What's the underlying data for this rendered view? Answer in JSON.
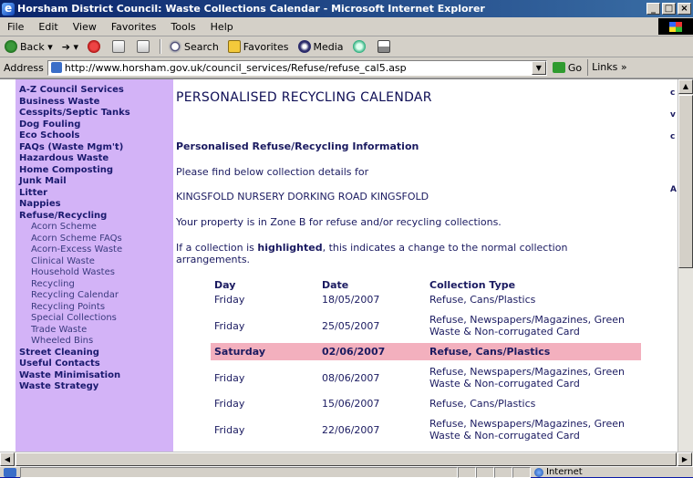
{
  "window": {
    "title": "Horsham District Council: Waste Collections Calendar - Microsoft Internet Explorer"
  },
  "menu": [
    {
      "label": "File"
    },
    {
      "label": "Edit"
    },
    {
      "label": "View"
    },
    {
      "label": "Favorites"
    },
    {
      "label": "Tools"
    },
    {
      "label": "Help"
    }
  ],
  "toolbar": {
    "back_label": "Back",
    "search_label": "Search",
    "favorites_label": "Favorites",
    "media_label": "Media"
  },
  "address": {
    "label": "Address",
    "url": "http://www.horsham.gov.uk/council_services/Refuse/refuse_cal5.asp",
    "go_label": "Go",
    "links_label": "Links"
  },
  "sidebar": {
    "items": [
      {
        "label": "A-Z Council Services",
        "sub": false
      },
      {
        "label": "Business Waste",
        "sub": false
      },
      {
        "label": "Cesspits/Septic Tanks",
        "sub": false
      },
      {
        "label": "Dog Fouling",
        "sub": false
      },
      {
        "label": "Eco Schools",
        "sub": false
      },
      {
        "label": "FAQs (Waste Mgm't)",
        "sub": false
      },
      {
        "label": "Hazardous Waste",
        "sub": false
      },
      {
        "label": "Home Composting",
        "sub": false
      },
      {
        "label": "Junk Mail",
        "sub": false
      },
      {
        "label": "Litter",
        "sub": false
      },
      {
        "label": "Nappies",
        "sub": false
      },
      {
        "label": "Refuse/Recycling",
        "sub": false
      },
      {
        "label": "Acorn Scheme",
        "sub": true
      },
      {
        "label": "Acorn Scheme FAQs",
        "sub": true
      },
      {
        "label": "Acorn-Excess Waste",
        "sub": true
      },
      {
        "label": "Clinical Waste",
        "sub": true
      },
      {
        "label": "Household Wastes",
        "sub": true
      },
      {
        "label": "Recycling",
        "sub": true
      },
      {
        "label": "Recycling Calendar",
        "sub": true
      },
      {
        "label": "Recycling Points",
        "sub": true
      },
      {
        "label": "Special Collections",
        "sub": true
      },
      {
        "label": "Trade Waste",
        "sub": true
      },
      {
        "label": "Wheeled Bins",
        "sub": true
      },
      {
        "label": "Street Cleaning",
        "sub": false
      },
      {
        "label": "Useful Contacts",
        "sub": false
      },
      {
        "label": "Waste Minimisation",
        "sub": false
      },
      {
        "label": "Waste Strategy",
        "sub": false
      }
    ]
  },
  "main": {
    "page_title": "PERSONALISED RECYCLING CALENDAR",
    "info_heading": "Personalised Refuse/Recycling Information",
    "intro": "Please find below collection details for",
    "address_line": "KINGSFOLD NURSERY DORKING ROAD KINGSFOLD",
    "zone_text": "Your property is in Zone B for refuse and/or recycling collections.",
    "note_pre": "If a collection is ",
    "note_bold": "highlighted",
    "note_post": ", this indicates a change to the normal collection",
    "note_line2": "arrangements.",
    "table": {
      "headers": [
        "Day",
        "Date",
        "Collection Type"
      ],
      "rows": [
        {
          "day": "Friday",
          "date": "18/05/2007",
          "type": "Refuse, Cans/Plastics",
          "highlight": false
        },
        {
          "day": "Friday",
          "date": "25/05/2007",
          "type": "Refuse, Newspapers/Magazines, Green Waste & Non-corrugated Card",
          "highlight": false
        },
        {
          "day": "Saturday",
          "date": "02/06/2007",
          "type": "Refuse, Cans/Plastics",
          "highlight": true
        },
        {
          "day": "Friday",
          "date": "08/06/2007",
          "type": "Refuse, Newspapers/Magazines, Green Waste & Non-corrugated Card",
          "highlight": false
        },
        {
          "day": "Friday",
          "date": "15/06/2007",
          "type": "Refuse, Cans/Plastics",
          "highlight": false
        },
        {
          "day": "Friday",
          "date": "22/06/2007",
          "type": "Refuse, Newspapers/Magazines, Green Waste & Non-corrugated Card",
          "highlight": false
        }
      ]
    }
  },
  "right_peek": [
    "c",
    "v",
    "c",
    "A"
  ],
  "status": {
    "zone_label": "Internet"
  }
}
